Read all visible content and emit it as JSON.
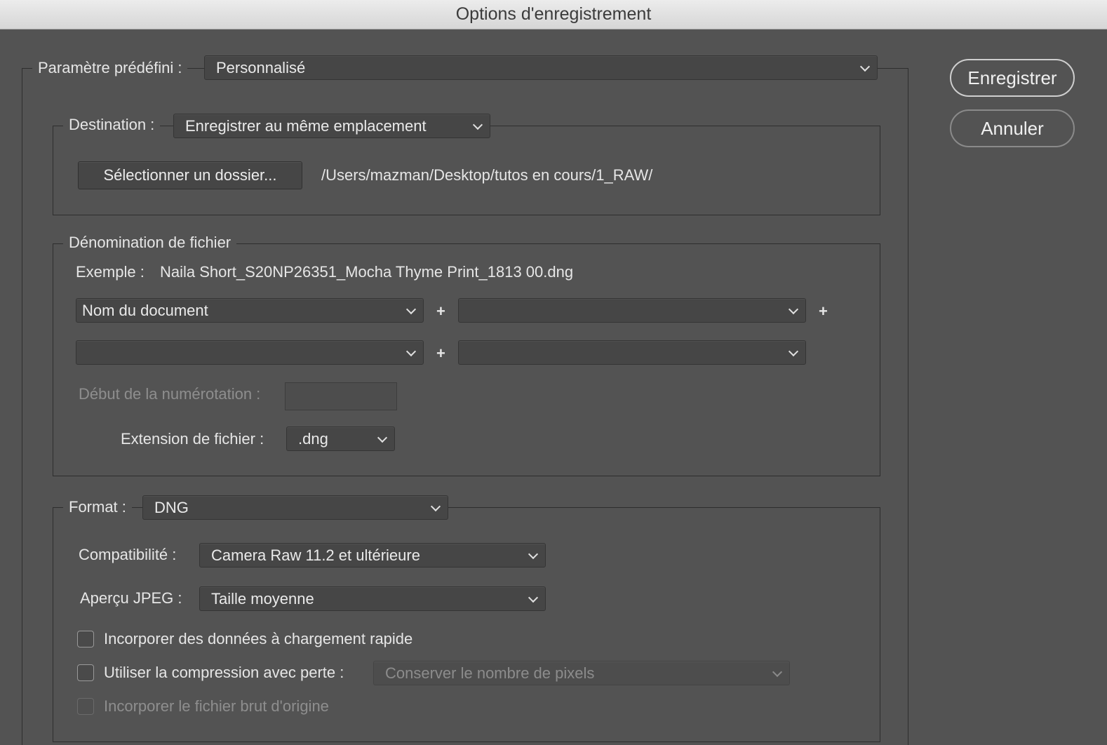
{
  "window": {
    "title": "Options d'enregistrement"
  },
  "actions": {
    "save_label": "Enregistrer",
    "cancel_label": "Annuler"
  },
  "preset": {
    "label": "Paramètre prédéfini :",
    "value": "Personnalisé"
  },
  "destination": {
    "label": "Destination :",
    "value": "Enregistrer au même emplacement",
    "select_folder_label": "Sélectionner un dossier...",
    "path": "/Users/mazman/Desktop/tutos en cours/1_RAW/"
  },
  "naming": {
    "section_label": "Dénomination de fichier",
    "example_label": "Exemple :",
    "example_value": "Naila Short_S20NP26351_Mocha Thyme Print_1813 00.dng",
    "fields": [
      "Nom du document",
      "",
      "",
      ""
    ],
    "plus": "+",
    "numbering_label": "Début de la numérotation :",
    "numbering_value": "",
    "extension_label": "Extension de fichier :",
    "extension_value": ".dng"
  },
  "format": {
    "label": "Format :",
    "value": "DNG",
    "compat_label": "Compatibilité :",
    "compat_value": "Camera Raw 11.2 et ultérieure",
    "preview_label": "Aperçu JPEG :",
    "preview_value": "Taille moyenne",
    "fast_load_label": "Incorporer des données à chargement rapide",
    "lossy_label": "Utiliser la compression avec perte :",
    "lossy_value": "Conserver le nombre de pixels",
    "embed_raw_label": "Incorporer le fichier brut d'origine"
  }
}
